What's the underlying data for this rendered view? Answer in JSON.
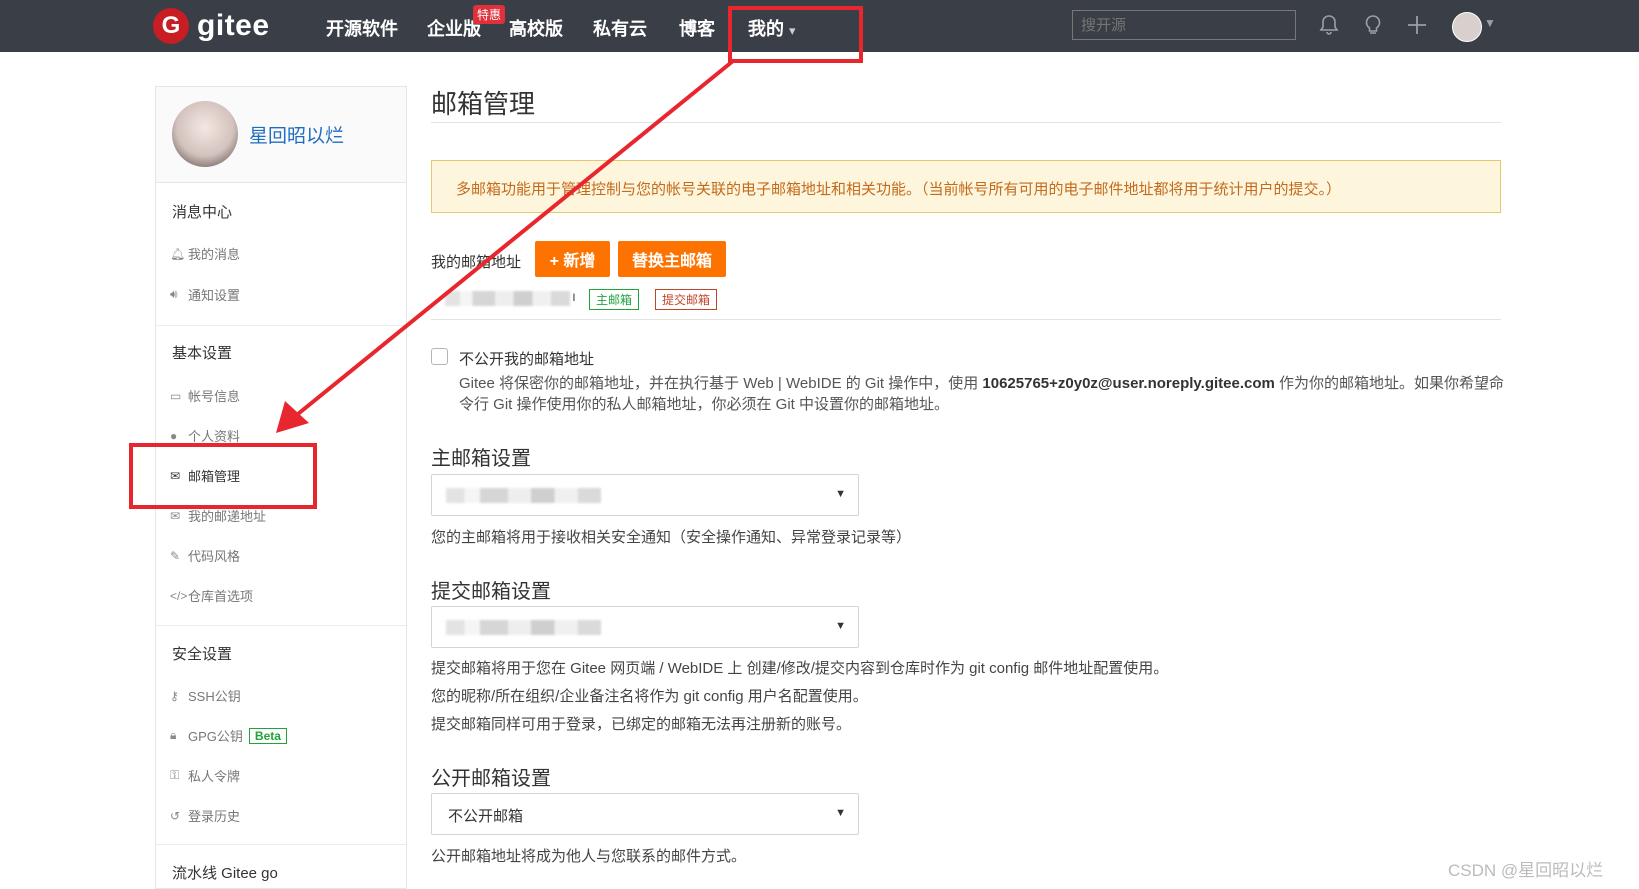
{
  "topbar": {
    "logo_letter": "G",
    "logo_text": "gitee",
    "nav": [
      "开源软件",
      "企业版",
      "高校版",
      "私有云",
      "博客",
      "我的"
    ],
    "hot_badge": "特惠",
    "search_placeholder": "搜开源",
    "mine_caret": "▾"
  },
  "sidebar": {
    "username": "星回昭以烂",
    "sections": [
      {
        "title": "消息中心",
        "items": [
          {
            "icon": "bell-icon",
            "label": "我的消息"
          },
          {
            "icon": "speaker-icon",
            "label": "通知设置"
          }
        ]
      },
      {
        "title": "基本设置",
        "items": [
          {
            "icon": "id-card-icon",
            "label": "帐号信息"
          },
          {
            "icon": "user-icon",
            "label": "个人资料"
          },
          {
            "icon": "envelope-icon",
            "label": "邮箱管理",
            "active": true
          },
          {
            "icon": "envelope-icon",
            "label": "我的邮递地址"
          },
          {
            "icon": "brush-icon",
            "label": "代码风格"
          },
          {
            "icon": "code-icon",
            "label": "仓库首选项"
          }
        ]
      },
      {
        "title": "安全设置",
        "items": [
          {
            "icon": "key-icon",
            "label": "SSH公钥"
          },
          {
            "icon": "lock-icon",
            "label": "GPG公钥",
            "badge": "Beta"
          },
          {
            "icon": "token-icon",
            "label": "私人令牌"
          },
          {
            "icon": "history-icon",
            "label": "登录历史"
          }
        ]
      },
      {
        "title": "流水线 Gitee go",
        "items": []
      }
    ]
  },
  "main": {
    "title": "邮箱管理",
    "notice": "多邮箱功能用于管理控制与您的帐号关联的电子邮箱地址和相关功能。（当前帐号所有可用的电子邮件地址都将用于统计用户的提交。）",
    "my_email_label": "我的邮箱地址",
    "add_button": "+ 新增",
    "replace_button": "替换主邮箱",
    "email_suffix": "ı",
    "tag_primary": "主邮箱",
    "tag_commit": "提交邮箱",
    "hide_email_label": "不公开我的邮箱地址",
    "hide_email_desc_1": "Gitee 将保密你的邮箱地址，并在执行基于 Web | WebIDE 的 Git 操作中，使用 ",
    "hide_email_desc_email": "10625765+z0y0z@user.noreply.gitee.com",
    "hide_email_desc_2": " 作为你的邮箱地址。如果你希望命令行 Git 操作使用你的私人邮箱地址，你必须在 Git 中设置你的邮箱地址。",
    "primary_title": "主邮箱设置",
    "primary_help": "您的主邮箱将用于接收相关安全通知（安全操作通知、异常登录记录等）",
    "commit_title": "提交邮箱设置",
    "commit_help": [
      "提交邮箱将用于您在 Gitee 网页端 / WebIDE 上 创建/修改/提交内容到仓库时作为 git config 邮件地址配置使用。",
      "您的昵称/所在组织/企业备注名将作为 git config 用户名配置使用。",
      "提交邮箱同样可用于登录，已绑定的邮箱无法再注册新的账号。"
    ],
    "public_title": "公开邮箱设置",
    "public_value": "不公开邮箱",
    "public_help": "公开邮箱地址将成为他人与您联系的邮件方式。"
  },
  "watermark": "CSDN @星回昭以烂",
  "colors": {
    "brand_red": "#c71d23",
    "accent_orange": "#fe7300",
    "annotation_red": "#e8262d",
    "link_blue": "#1f6dc2"
  }
}
